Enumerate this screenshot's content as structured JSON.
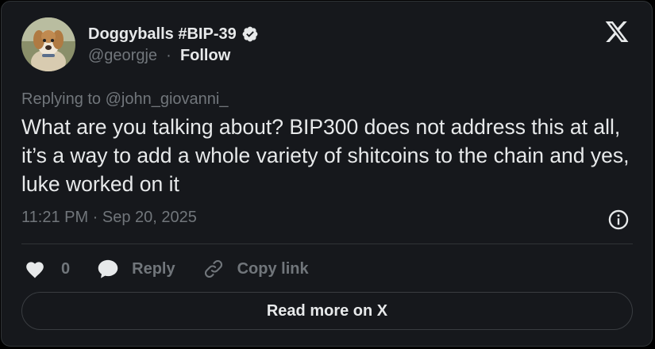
{
  "author": {
    "display_name": "Doggyballs #BIP-39",
    "handle": "@georgje",
    "separator": "·",
    "follow_label": "Follow",
    "verified": true,
    "avatar_icon": "dog-avatar"
  },
  "tweet": {
    "replying_to": "Replying to @john_giovanni_",
    "text": "What are you talking about? BIP300 does not address this at all, it’s a way to add a whole variety of shitcoins to the chain and yes, luke worked on it",
    "timestamp": "11:21 PM · Sep 20, 2025"
  },
  "actions": {
    "like_count": "0",
    "reply_label": "Reply",
    "copy_link_label": "Copy link"
  },
  "footer": {
    "read_more_label": "Read more on X"
  },
  "colors": {
    "background": "#000000",
    "card": "#16181c",
    "text": "#e7e9ea",
    "muted": "#71767b",
    "border": "#2f3336"
  },
  "icons": [
    "x-logo-icon",
    "verified-badge-icon",
    "info-icon",
    "heart-icon",
    "reply-bubble-icon",
    "link-icon"
  ]
}
